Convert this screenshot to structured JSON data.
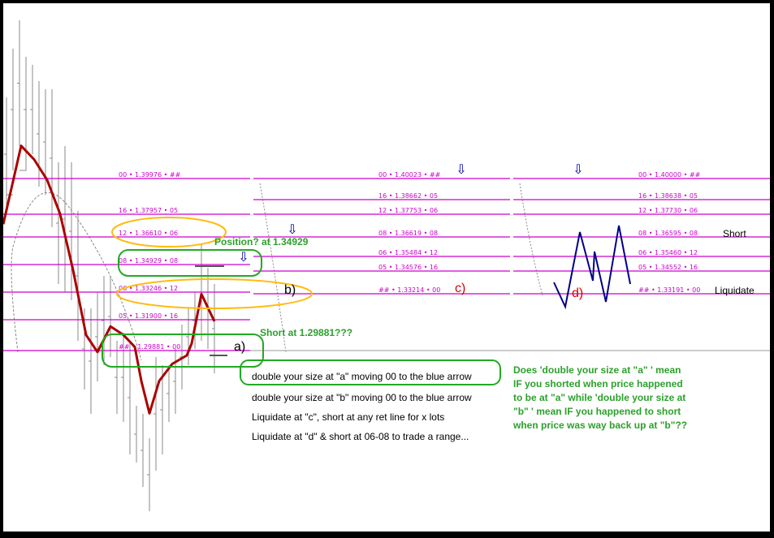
{
  "chart_data": {
    "type": "line",
    "title": "",
    "xlabel": "",
    "ylabel": "",
    "colors": {
      "price_line": "#aa0000",
      "bars": "#888888",
      "levels": "#cc00cc",
      "arrows": "#0000aa",
      "annotation_green": "#22aa22",
      "annotation_orange": "#ffbb11",
      "label_red": "#dd0000"
    },
    "price_series": [
      {
        "x": 0,
        "y": 1.372
      },
      {
        "x": 1,
        "y": 1.418
      },
      {
        "x": 2,
        "y": 1.41
      },
      {
        "x": 3,
        "y": 1.398
      },
      {
        "x": 4,
        "y": 1.378
      },
      {
        "x": 5,
        "y": 1.345
      },
      {
        "x": 6,
        "y": 1.307
      },
      {
        "x": 7,
        "y": 1.297
      },
      {
        "x": 8,
        "y": 1.312
      },
      {
        "x": 9,
        "y": 1.307
      },
      {
        "x": 10,
        "y": 1.3
      },
      {
        "x": 11,
        "y": 1.28
      },
      {
        "x": 12,
        "y": 1.261
      },
      {
        "x": 13,
        "y": 1.28
      },
      {
        "x": 14,
        "y": 1.29
      },
      {
        "x": 15,
        "y": 1.295
      },
      {
        "x": 16,
        "y": 1.302
      },
      {
        "x": 17,
        "y": 1.331
      },
      {
        "x": 18,
        "y": 1.315
      }
    ],
    "groups": [
      {
        "id": "a-b",
        "levels": [
          {
            "label": "00 • 1.39976 • ##",
            "value": 1.39976
          },
          {
            "label": "16 • 1.37957 • 05",
            "value": 1.37957
          },
          {
            "label": "12 • 1.36610 • 06",
            "value": 1.3661
          },
          {
            "label": "08 • 1.34929 • 08",
            "value": 1.34929
          },
          {
            "label": "06 • 1.33246 • 12",
            "value": 1.33246
          },
          {
            "label": "05 • 1.31900 • 16",
            "value": 1.319
          },
          {
            "label": "## • 1.29881 • 00",
            "value": 1.29881
          }
        ]
      },
      {
        "id": "c",
        "levels": [
          {
            "label": "00 • 1.40023 • ##",
            "value": 1.40023
          },
          {
            "label": "16 • 1.38662 • 05",
            "value": 1.38662
          },
          {
            "label": "12 • 1.37753 • 06",
            "value": 1.37753
          },
          {
            "label": "08 • 1.36619 • 08",
            "value": 1.36619
          },
          {
            "label": "06 • 1.35484 • 12",
            "value": 1.35484
          },
          {
            "label": "05 • 1.34576 • 16",
            "value": 1.34576
          },
          {
            "label": "## • 1.33214 • 00",
            "value": 1.33214
          }
        ]
      },
      {
        "id": "d",
        "levels": [
          {
            "label": "00 • 1.40000 • ##",
            "value": 1.4
          },
          {
            "label": "16 • 1.38638 • 05",
            "value": 1.38638
          },
          {
            "label": "12 • 1.37730 • 06",
            "value": 1.3773
          },
          {
            "label": "08 • 1.36595 • 08",
            "value": 1.36595
          },
          {
            "label": "06 • 1.35460 • 12",
            "value": 1.3546
          },
          {
            "label": "05 • 1.34552 • 16",
            "value": 1.34552
          },
          {
            "label": "## • 1.33191 • 00",
            "value": 1.33191
          }
        ]
      }
    ],
    "point_labels": {
      "a": "a)",
      "b": "b)",
      "c": "c)",
      "d": "d)"
    },
    "side_labels": {
      "short": "Short",
      "liquidate": "Liquidate"
    },
    "annotations": {
      "position": "Position? at 1.34929",
      "short_at": "Short at 1.29881???"
    },
    "notes": [
      "double your size at \"a\" moving 00 to the blue arrow",
      "double your size at \"b\" moving 00 to the blue arrow",
      "Liquidate at \"c\", short at any ret line for x lots",
      "Liquidate at \"d\" & short at 06-08 to trade a range..."
    ],
    "question": [
      "Does 'double your size at \"a\" ' mean",
      "IF you shorted when price happened",
      "to be at \"a\" while 'double your size at",
      "\"b\" ' mean IF you happened to short",
      "when price was way back up at \"b\"??"
    ],
    "arrow_glyph": "⇩"
  }
}
